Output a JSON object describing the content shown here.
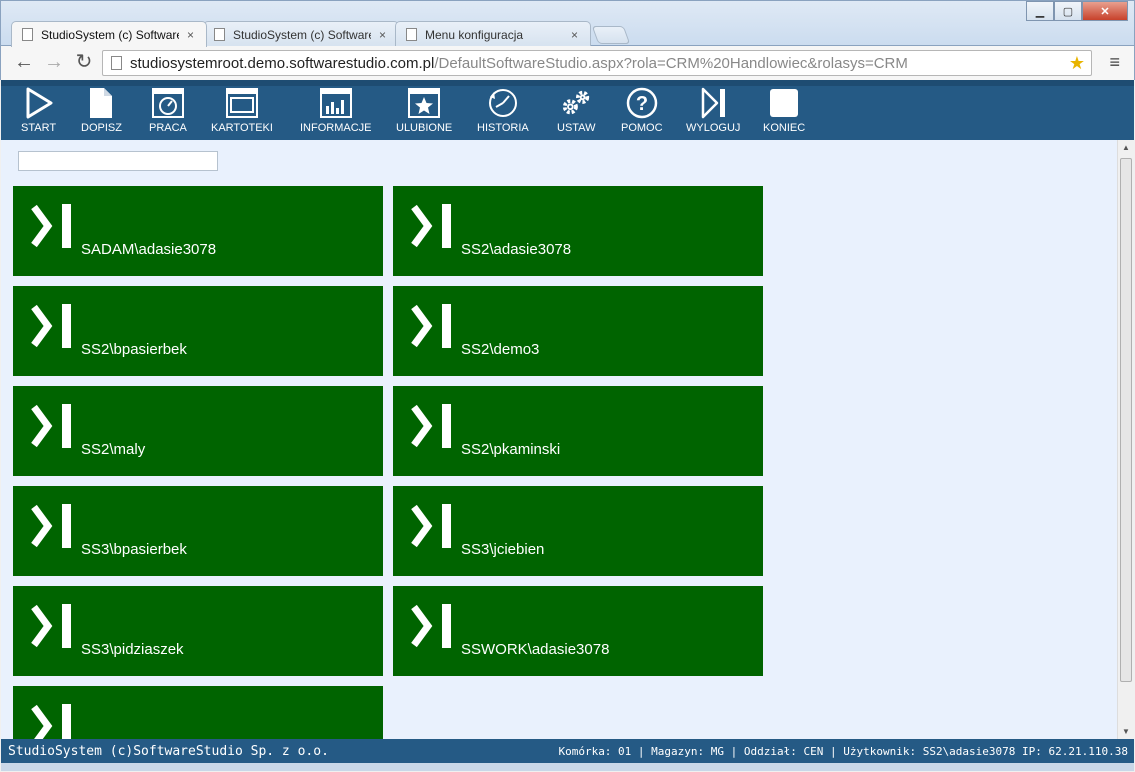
{
  "browser": {
    "tabs": [
      {
        "title": "StudioSystem (c) Software",
        "close": "×",
        "active": true
      },
      {
        "title": "StudioSystem (c) Software",
        "close": "×",
        "active": false
      },
      {
        "title": "Menu konfiguracja",
        "close": "×",
        "active": false
      }
    ],
    "back": "←",
    "forward": "→",
    "reload": "↻",
    "url_host": "studiosystemroot.demo.softwarestudio.com.pl",
    "url_path": "/DefaultSoftwareStudio.aspx?rola=CRM%20Handlowiec&rolasys=CRM",
    "star": "★",
    "menu": "≡",
    "window_buttons": {
      "minimize": "▁",
      "maximize": "▢",
      "close": "✕"
    }
  },
  "toolbar": {
    "items": [
      {
        "label": "START",
        "icon": "play-icon"
      },
      {
        "label": "DOPISZ",
        "icon": "document-icon"
      },
      {
        "label": "PRACA",
        "icon": "clock-window-icon"
      },
      {
        "label": "KARTOTEKI",
        "icon": "window-icon"
      },
      {
        "label": "INFORMACJE",
        "icon": "bar-chart-icon"
      },
      {
        "label": "ULUBIONE",
        "icon": "star-window-icon"
      },
      {
        "label": "HISTORIA",
        "icon": "history-icon"
      },
      {
        "label": "USTAW",
        "icon": "gears-icon"
      },
      {
        "label": "POMOC",
        "icon": "help-icon"
      },
      {
        "label": "WYLOGUJ",
        "icon": "logout-icon"
      },
      {
        "label": "KONIEC",
        "icon": "stop-icon"
      }
    ]
  },
  "search": {
    "value": "",
    "placeholder": ""
  },
  "tiles": [
    {
      "label": "SADAM\\adasie3078"
    },
    {
      "label": "SS2\\adasie3078"
    },
    {
      "label": "SS2\\bpasierbek"
    },
    {
      "label": "SS2\\demo3"
    },
    {
      "label": "SS2\\maly"
    },
    {
      "label": "SS2\\pkaminski"
    },
    {
      "label": "SS3\\bpasierbek"
    },
    {
      "label": "SS3\\jciebien"
    },
    {
      "label": "SS3\\pidziaszek"
    },
    {
      "label": "SSWORK\\adasie3078"
    },
    {
      "label": ""
    }
  ],
  "status": {
    "left": "StudioSystem (c)SoftwareStudio Sp. z o.o.",
    "right": "Komórka: 01 | Magazyn: MG | Oddział: CEN | Użytkownik: SS2\\adasie3078 IP: 62.21.110.38"
  },
  "colors": {
    "tile": "#006400",
    "bar": "#255a85",
    "background": "#e9f1fd"
  }
}
